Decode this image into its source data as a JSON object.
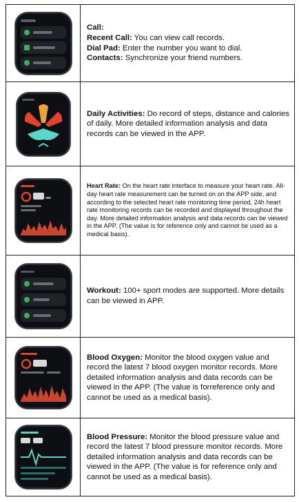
{
  "rows": [
    {
      "id": "call",
      "icon": "call-menu-screen-icon",
      "lines": [
        {
          "label": "Call:",
          "text": ""
        },
        {
          "label": "Recent Call:",
          "text": " You can view call records."
        },
        {
          "label": "Dial Pad:",
          "text": " Enter the number you want to dial."
        },
        {
          "label": "Contacts:",
          "text": " Synchronize your friend numbers."
        }
      ]
    },
    {
      "id": "daily-activities",
      "icon": "activity-rings-screen-icon",
      "label": "Daily Activities:",
      "text": " Do record of steps, distance and calories of daily. More detailed information analysis and data records can be viewed in the APP."
    },
    {
      "id": "heart-rate",
      "icon": "heart-rate-screen-icon",
      "label": "Heart Rate:",
      "text": " On the heart rate interface to measure your heart rate. All-day heart rate measurement can be turned on on the APP side, and according to the selected heart rate monitoring time period, 24h heart rate monitoring records can be recorded and displayed throughout the day. More detailed information analysis and data records can be viewed in the APP. (The value is for reference only and cannot be used as a medical basis)."
    },
    {
      "id": "workout",
      "icon": "workout-menu-screen-icon",
      "label": "Workout:",
      "text": " 100+ sport modes are supported. More details can be viewed in APP."
    },
    {
      "id": "blood-oxygen",
      "icon": "blood-oxygen-screen-icon",
      "label": "Blood Oxygen:",
      "text": " Monitor the blood oxygen value and record the latest 7 blood oxygen monitor records. More detailed information analysis and data records can be viewed in the APP. (The value is forreference only and cannot be used as a medical basis)."
    },
    {
      "id": "blood-pressure",
      "icon": "blood-pressure-screen-icon",
      "label": "Blood Pressure:",
      "text": " Monitor the blood pressure value and record the latest 7 blood pressure monitor records. More detailed information analysis and data records can be viewed in the APP. (The value is for reference only and cannot be used as a medical basis)."
    }
  ],
  "colors": {
    "accent_red": "#e0442c",
    "accent_orange": "#f0a23a",
    "accent_teal": "#5cd6c8",
    "menu_green": "#3fae5a"
  }
}
